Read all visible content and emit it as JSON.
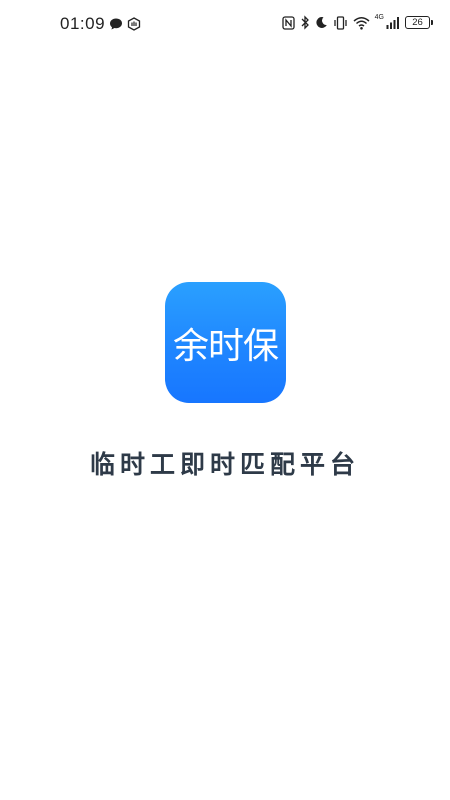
{
  "status_bar": {
    "time": "01:09",
    "battery_level": "26",
    "network_type": "4G",
    "icons_left": [
      "message-icon",
      "app-notification-icon"
    ],
    "icons_right": [
      "nfc-icon",
      "bluetooth-icon",
      "do-not-disturb-icon",
      "vibrate-icon",
      "wifi-icon",
      "cellular-signal-icon",
      "battery-icon"
    ]
  },
  "splash": {
    "logo_text": "余时保",
    "slogan": "临时工即时匹配平台"
  },
  "colors": {
    "logo_gradient_top": "#2aa0ff",
    "logo_gradient_bottom": "#1776ff",
    "slogan_color": "#2e3a48",
    "background": "#ffffff"
  }
}
